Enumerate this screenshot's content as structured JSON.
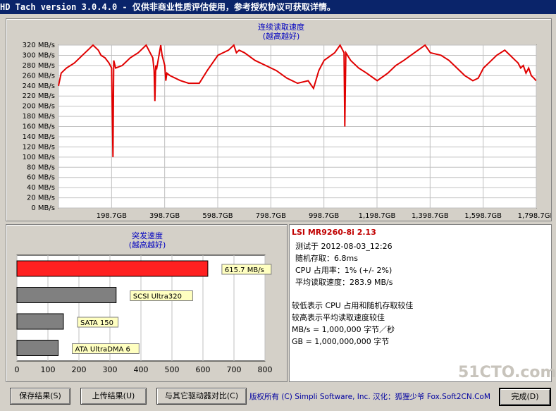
{
  "window": {
    "title": "HD Tach version 3.0.4.0  - 仅供非商业性质评估使用，参考授权协议可获取详情。"
  },
  "read_chart": {
    "title_line1": "连续读取速度",
    "title_line2": "(越高越好)",
    "color": "#e00000",
    "chart_data": {
      "type": "line",
      "xlabels": [
        "198.7GB",
        "398.7GB",
        "598.7GB",
        "798.7GB",
        "998.7GB",
        "1,198.7GB",
        "1,398.7GB",
        "1,598.7GB",
        "1,798.7GB"
      ],
      "ylabels": [
        "320 MB/s",
        "300 MB/s",
        "280 MB/s",
        "260 MB/s",
        "240 MB/s",
        "220 MB/s",
        "200 MB/s",
        "180 MB/s",
        "160 MB/s",
        "140 MB/s",
        "120 MB/s",
        "100 MB/s",
        "80 MB/s",
        "60 MB/s",
        "40 MB/s",
        "20 MB/s",
        "0 MB/s"
      ],
      "xlim": [
        0,
        1798.7
      ],
      "ylim": [
        0,
        320
      ],
      "grid": true,
      "points": [
        [
          0,
          240
        ],
        [
          10,
          265
        ],
        [
          30,
          275
        ],
        [
          60,
          285
        ],
        [
          100,
          305
        ],
        [
          130,
          320
        ],
        [
          150,
          310
        ],
        [
          160,
          300
        ],
        [
          175,
          295
        ],
        [
          190,
          285
        ],
        [
          200,
          275
        ],
        [
          205,
          100
        ],
        [
          208,
          290
        ],
        [
          215,
          275
        ],
        [
          240,
          280
        ],
        [
          270,
          295
        ],
        [
          300,
          305
        ],
        [
          330,
          320
        ],
        [
          345,
          305
        ],
        [
          355,
          295
        ],
        [
          360,
          270
        ],
        [
          363,
          210
        ],
        [
          366,
          280
        ],
        [
          370,
          275
        ],
        [
          385,
          320
        ],
        [
          390,
          300
        ],
        [
          400,
          280
        ],
        [
          404,
          250
        ],
        [
          408,
          265
        ],
        [
          420,
          260
        ],
        [
          460,
          250
        ],
        [
          490,
          245
        ],
        [
          530,
          245
        ],
        [
          560,
          270
        ],
        [
          600,
          300
        ],
        [
          640,
          310
        ],
        [
          660,
          320
        ],
        [
          670,
          305
        ],
        [
          680,
          310
        ],
        [
          700,
          305
        ],
        [
          740,
          290
        ],
        [
          780,
          280
        ],
        [
          820,
          270
        ],
        [
          860,
          255
        ],
        [
          900,
          245
        ],
        [
          940,
          250
        ],
        [
          960,
          235
        ],
        [
          980,
          270
        ],
        [
          1000,
          290
        ],
        [
          1040,
          305
        ],
        [
          1060,
          320
        ],
        [
          1070,
          310
        ],
        [
          1075,
          305
        ],
        [
          1078,
          160
        ],
        [
          1082,
          305
        ],
        [
          1100,
          290
        ],
        [
          1130,
          275
        ],
        [
          1160,
          265
        ],
        [
          1200,
          250
        ],
        [
          1240,
          265
        ],
        [
          1270,
          280
        ],
        [
          1300,
          290
        ],
        [
          1340,
          305
        ],
        [
          1380,
          320
        ],
        [
          1400,
          305
        ],
        [
          1440,
          300
        ],
        [
          1470,
          290
        ],
        [
          1500,
          275
        ],
        [
          1530,
          260
        ],
        [
          1560,
          250
        ],
        [
          1580,
          255
        ],
        [
          1600,
          275
        ],
        [
          1620,
          285
        ],
        [
          1650,
          300
        ],
        [
          1680,
          310
        ],
        [
          1700,
          300
        ],
        [
          1720,
          290
        ],
        [
          1730,
          285
        ],
        [
          1740,
          275
        ],
        [
          1750,
          280
        ],
        [
          1760,
          265
        ],
        [
          1770,
          275
        ],
        [
          1780,
          260
        ],
        [
          1790,
          255
        ],
        [
          1798,
          250
        ]
      ]
    }
  },
  "burst_chart": {
    "title_line1": "突发速度",
    "title_line2": "(越高越好)",
    "chart_data": {
      "type": "bar",
      "categories": [
        "615.7 MB/s",
        "SCSI Ultra320",
        "SATA 150",
        "ATA UltraDMA 6"
      ],
      "values": [
        615.7,
        320,
        150,
        133
      ],
      "colors": [
        "#ff2020",
        "#808080",
        "#808080",
        "#808080"
      ],
      "xlim": [
        0,
        800
      ],
      "xticks": [
        "0",
        "100",
        "200",
        "300",
        "400",
        "500",
        "600",
        "700",
        "800"
      ]
    }
  },
  "info": {
    "drive_name": "LSI MR9260-8i 2.13",
    "drive_color": "#c00000",
    "test_time": "测试于 2012-08-03_12:26",
    "random_access": "随机存取：6.8ms",
    "cpu_usage": "CPU 占用率：1% (+/- 2%)",
    "avg_read": "平均读取速度：283.9 MB/s",
    "note1": "较低表示 CPU 占用和随机存取较佳",
    "note2": "较高表示平均读取速度较佳",
    "note3": "MB/s = 1,000,000 字节／秒",
    "note4": "GB = 1,000,000,000 字节"
  },
  "buttons": {
    "save": "保存结果(S)",
    "upload": "上传结果(U)",
    "compare": "与其它驱动器对比(C)",
    "done": "完成(D)"
  },
  "footer": {
    "copyright": "版权所有 (C) Simpli Software, Inc. 汉化：狐狸少爷 Fox.Soft2CN.CoM",
    "watermark": "51CTO.com"
  }
}
